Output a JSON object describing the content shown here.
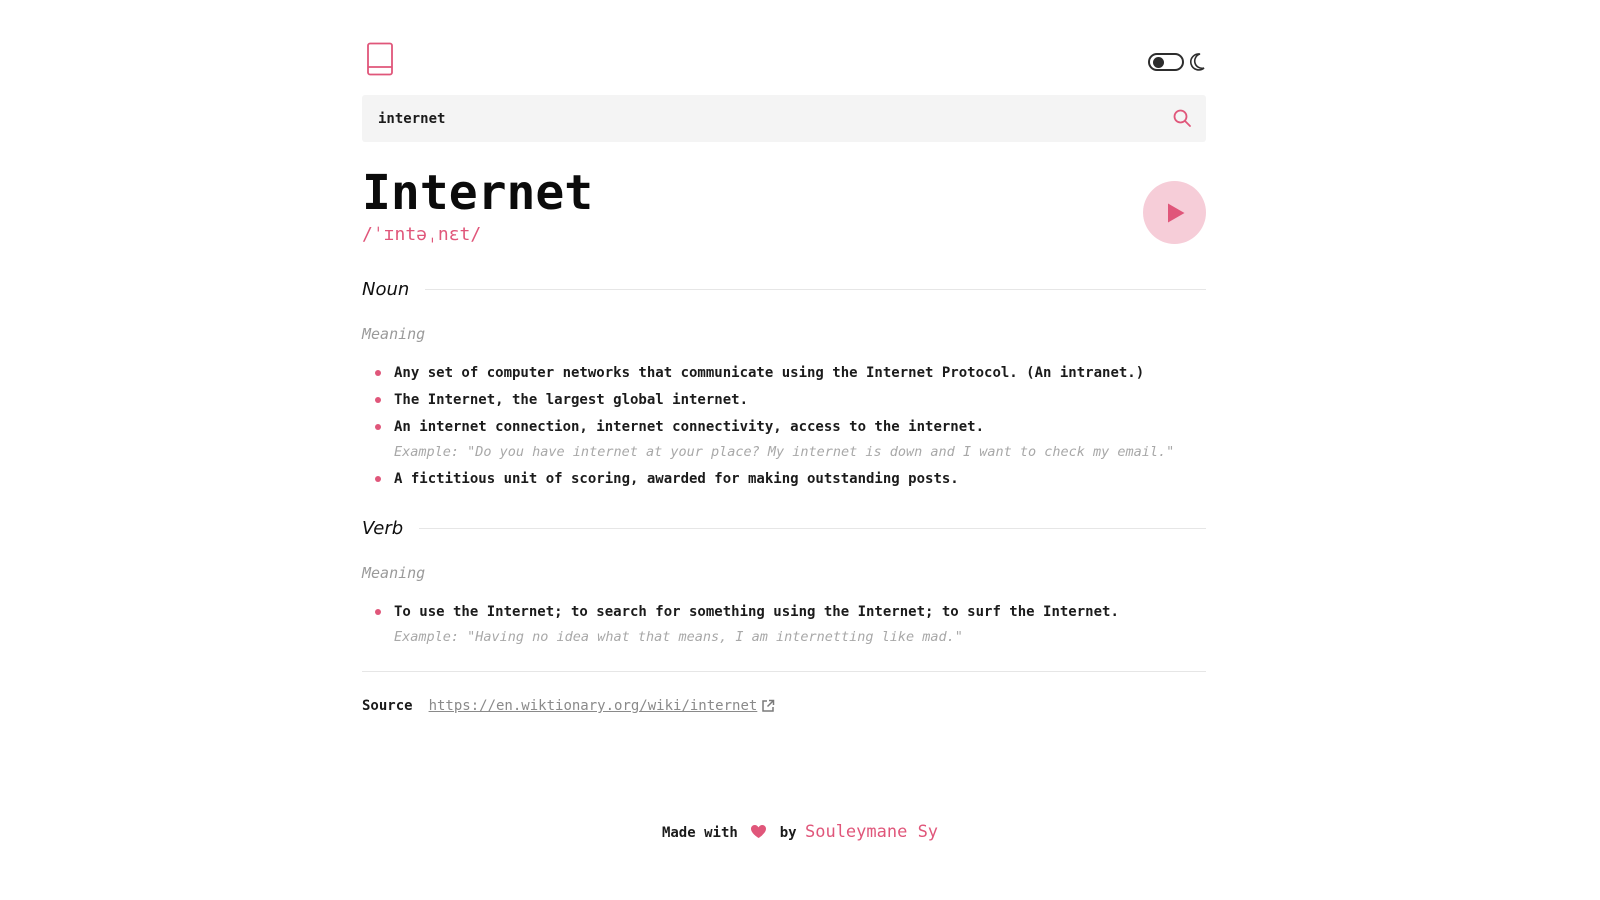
{
  "header": {
    "logo_icon": "book-icon",
    "theme_toggle_icon": "moon-icon",
    "theme_state": "light"
  },
  "search": {
    "value": "internet",
    "icon": "search-icon"
  },
  "entry": {
    "word": "Internet",
    "phonetic": "/ˈɪntəˌnɛt/",
    "play_icon": "play-icon"
  },
  "meanings": [
    {
      "part_of_speech": "Noun",
      "meaning_label": "Meaning",
      "definitions": [
        {
          "text": "Any set of computer networks that communicate using the Internet Protocol. (An intranet.)",
          "example": ""
        },
        {
          "text": "The Internet, the largest global internet.",
          "example": ""
        },
        {
          "text": "An internet connection, internet connectivity, access to the internet.",
          "example": "Example: \"Do you have internet at your place?  My internet is down and I want to check my email.\""
        },
        {
          "text": "A fictitious unit of scoring, awarded for making outstanding posts.",
          "example": ""
        }
      ]
    },
    {
      "part_of_speech": "Verb",
      "meaning_label": "Meaning",
      "definitions": [
        {
          "text": "To use the Internet; to search for something using the Internet; to surf the Internet.",
          "example": "Example: \"Having no idea what that means, I am internetting like mad.\""
        }
      ]
    }
  ],
  "source": {
    "label": "Source",
    "url": "https://en.wiktionary.org/wiki/internet",
    "icon": "external-link-icon"
  },
  "footer": {
    "made_with": "Made with",
    "heart_icon": "heart-icon",
    "by": "by",
    "author": "Souleymane Sy"
  },
  "colors": {
    "accent": "#e0567a",
    "accent_soft": "#f6cdd8",
    "search_bg": "#f4f4f4",
    "muted": "#9a9a9a"
  }
}
